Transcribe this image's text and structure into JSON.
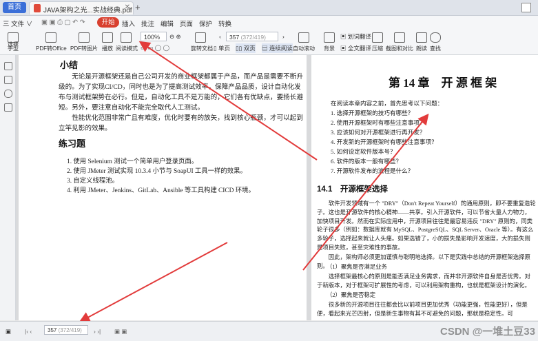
{
  "tabs": {
    "home": "首页",
    "document": "JAVA架构之光...实战经典.pdf"
  },
  "menu": {
    "file": "三 文件 ∨",
    "items": [
      "开始",
      "插入",
      "批注",
      "编辑",
      "页面",
      "保护",
      "转换"
    ]
  },
  "toolbar": {
    "tools_left": [
      "手型",
      "选择",
      "PDF转Office",
      "PDF转图片",
      "播放",
      "阅读模式"
    ],
    "zoom": "100%",
    "page_input": "357",
    "page_total": "(372/419)",
    "rotate": "旋转文档",
    "single": "单页",
    "double": "双页",
    "continuous": "连续阅读",
    "autoscroll": "自动滚动",
    "background": "背景",
    "fulltext": "全文翻译",
    "compress": "压缩",
    "screenshot": "截图和对比",
    "read": "朗读",
    "search": "查找",
    "translate": "划词翻译"
  },
  "left_page": {
    "summary_title": "小结",
    "summary_p1": "无论是开源框架还是自己公司开发的商业框架都属于产品，而产品是需要不断升级的。为了实现CI/CD，同时也是为了提高测试效率，保障产品品质，设计自动化发布与测试框架势在必行。但是，自动化工具不是万能的，它们各有优缺点，要扬长避短。另外，要注意自动化不能完全取代人工测试。",
    "summary_p2": "性能优化范围非常广且有难度，优化时要有的放矢，找到核心瓶颈，才可以起到立竿见影的效果。",
    "exercise_title": "练习题",
    "exercises": [
      "1. 使用 Selenium 测试一个简单用户登录页面。",
      "2. 使用 JMeter 测试实现 10.3.4 小节与 SoapUI 工具一样的效果。",
      "3. 自定义线程池。",
      "4. 利用 JMeter、Jenkins、GitLab、Ansible 等工具构建 CICD 环境。"
    ]
  },
  "right_page": {
    "chapter_title": "第 14 章　开 源 框 架",
    "intro": "在阅读本章内容之前，首先思考以下问题：",
    "questions": [
      "1. 选择开源框架的技巧有哪些？",
      "2. 使用开源框架时有哪些注意事项？",
      "3. 应该如何对开源框架进行再开发？",
      "4. 开发新的开源框架时有哪些注意事项？",
      "5. 如何设定软件版本号？",
      "6. 软件的版本一般有哪些？",
      "7. 开源软件发布的流程是什么？"
    ],
    "section_title": "14.1　开源框架选择",
    "p1": "软件开发领域有一个 \"DRY\"（Don't Repeat Yourself）的通用原则，即不要重复造轮子。这也是开源软件的核心精神——共享。引入开源软件，可以节省大量人力物力，加快项目开发。然而在实际应用中，开源项目往往是最容易违反 \"DRY\" 原则的，同类轮子很多（例如：数据库就有 MySQL、PostgreSQL、SQL Server、Oracle 等）。有这么多轮子，选择起来就让人头痛。如果选错了，小的损失是影响开发速度，大的损失则是项目失败，甚至灾难性的事故。",
    "p2": "因此，架构师必须更加谨慎与聪明地选择。以下是实践中总结的开源框架选择原则。",
    "sub1": "（1）聚焦是否满足业务",
    "p3": "选择框架最核心的原则是能否满足业务需求，而并非开源软件自身是否优秀。对于新版本，对于框架可扩展性的考虑，可以利用架构重构，也就是框架设计的演化。",
    "sub2": "（2）聚焦是否稳定",
    "p4": "很多新的开源项目往往都会比以前项目更加优秀（功能更强，性能更好），但是便，看起来光芒四射，但是新生事物有其不可避免的问题，那就是稳定性。可"
  },
  "status": {
    "page_input": "357",
    "page_total": "(372/419)"
  },
  "watermark": "CSDN @一堆土豆33"
}
